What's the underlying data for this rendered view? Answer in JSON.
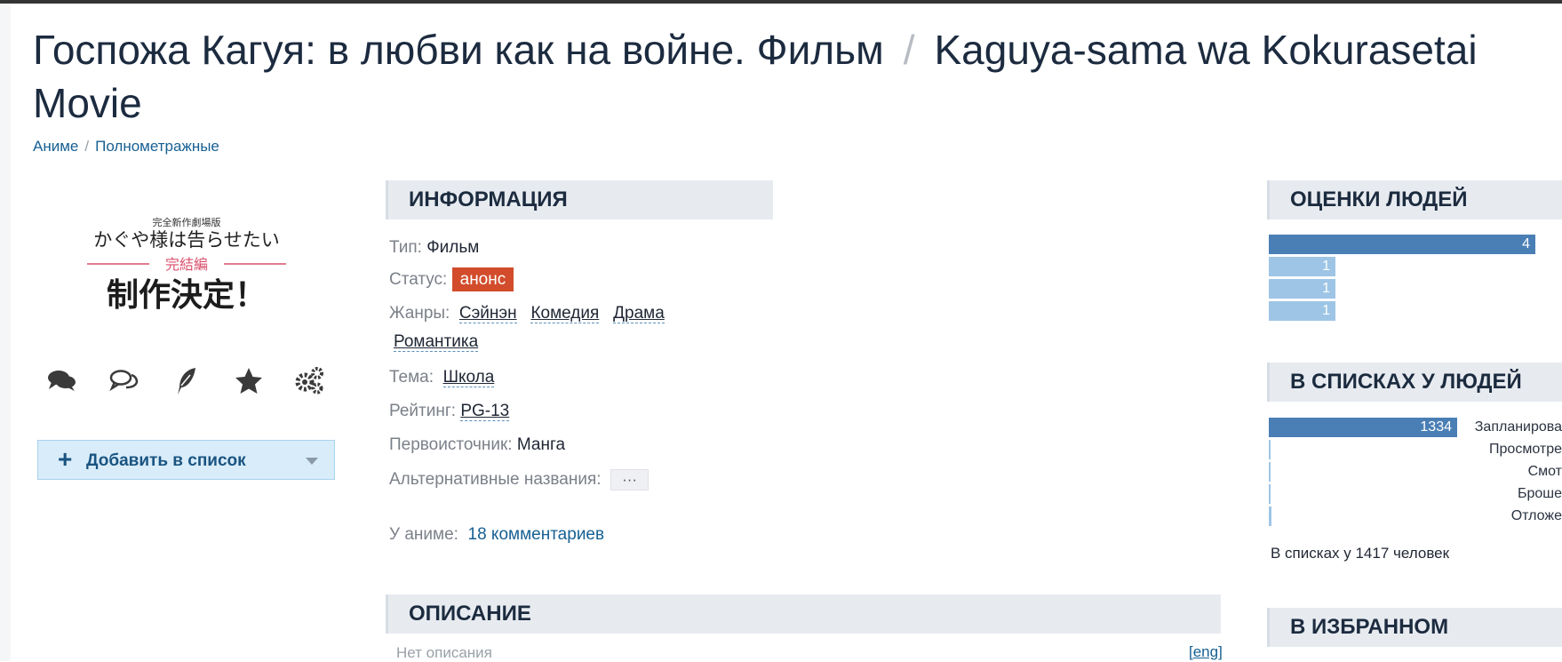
{
  "title": {
    "ru": "Госпожа Кагуя: в любви как на войне. Фильм",
    "separator": "/",
    "en_line1": "Kaguya-sama wa Kokurasetai",
    "en_line2": "Movie"
  },
  "breadcrumbs": {
    "item1": "Аниме",
    "separator": "/",
    "item2": "Полнометражные"
  },
  "poster": {
    "line1": "完全新作劇場版",
    "line2": "かぐや様は告らせたい",
    "line3": "完結編",
    "line4": "制作決定！"
  },
  "actions": {
    "icons": [
      "comments-icon",
      "discussion-icon",
      "review-feather-icon",
      "favorite-star-icon",
      "settings-gears-icon"
    ],
    "add_to_list": "Добавить в список"
  },
  "info": {
    "heading": "ИНФОРМАЦИЯ",
    "type_label": "Тип:",
    "type_value": "Фильм",
    "status_label": "Статус:",
    "status_value": "анонс",
    "genres_label": "Жанры:",
    "genres": [
      "Сэйнэн",
      "Комедия",
      "Драма",
      "Романтика"
    ],
    "theme_label": "Тема:",
    "theme_value": "Школа",
    "rating_label": "Рейтинг:",
    "rating_value": "PG-13",
    "source_label": "Первоисточник:",
    "source_value": "Манга",
    "alt_names_label": "Альтернативные названия:",
    "alt_names_button": "···",
    "anime_comments_label": "У аниме:",
    "anime_comments_value": "18 комментариев"
  },
  "description": {
    "heading": "ОПИСАНИЕ",
    "empty_text": "Нет описания",
    "lang_link": "[eng]"
  },
  "ratings": {
    "heading": "ОЦЕНКИ ЛЮДЕЙ",
    "counts": [
      4,
      1,
      1,
      1
    ]
  },
  "lists": {
    "heading": "В СПИСКАХ У ЛЮДЕЙ",
    "rows": [
      {
        "label": "Запланирова",
        "count": 1334,
        "show_count": "1334"
      },
      {
        "label": "Просмотре",
        "count": 3
      },
      {
        "label": "Смот",
        "count": 8
      },
      {
        "label": "Броше",
        "count": 3
      },
      {
        "label": "Отложе",
        "count": 18
      }
    ],
    "total_text": "В списках у 1417 человек"
  },
  "favorites": {
    "heading": "В ИЗБРАННОМ"
  },
  "colors": {
    "bar_dark": "#4a7fb5",
    "bar_light": "#9ec5e6",
    "status_badge": "#d24c2b",
    "link": "#176093"
  }
}
